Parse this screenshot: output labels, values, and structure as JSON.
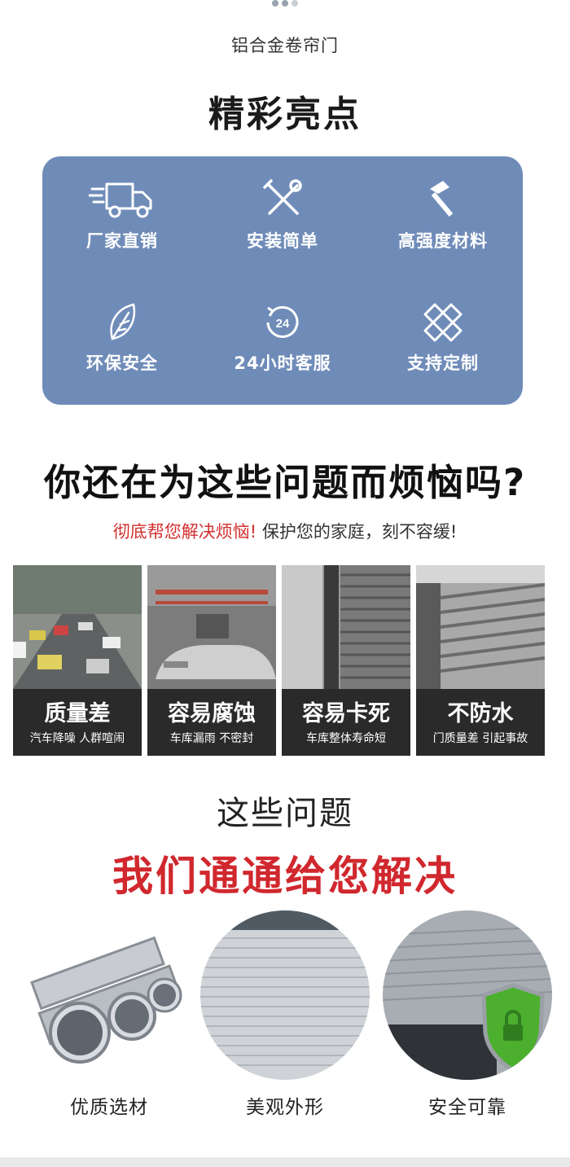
{
  "header": {
    "subtitle": "铝合金卷帘门",
    "title": "精彩亮点"
  },
  "highlights": [
    {
      "label": "厂家直销",
      "icon": "truck-icon"
    },
    {
      "label": "安装简单",
      "icon": "tools-icon"
    },
    {
      "label": "高强度材料",
      "icon": "hammer-icon"
    },
    {
      "label": "环保安全",
      "icon": "leaf-icon"
    },
    {
      "label": "24小时客服",
      "icon": "24-hour-service-icon",
      "icon_text": "24"
    },
    {
      "label": "支持定制",
      "icon": "ruler-pencil-icon"
    }
  ],
  "problem_section": {
    "question": "你还在为这些问题而烦恼吗?",
    "tagline_red": "彻底帮您解决烦恼!",
    "tagline_dark": "保护您的家庭，刻不容缓!",
    "cards": [
      {
        "title": "质量差",
        "subtitle": "汽车降噪 人群喧闹"
      },
      {
        "title": "容易腐蚀",
        "subtitle": "车库漏雨 不密封"
      },
      {
        "title": "容易卡死",
        "subtitle": "车库整体寿命短"
      },
      {
        "title": "不防水",
        "subtitle": "门质量差 引起事故"
      }
    ]
  },
  "solution_section": {
    "line1": "这些问题",
    "line2": "我们通通给您解决",
    "features": [
      {
        "label": "优质选材"
      },
      {
        "label": "美观外形"
      },
      {
        "label": "安全可靠"
      }
    ]
  },
  "colors": {
    "panel": "#6f8cb9",
    "accent_red": "#d0282e",
    "dark_band": "#2a2a2a"
  }
}
